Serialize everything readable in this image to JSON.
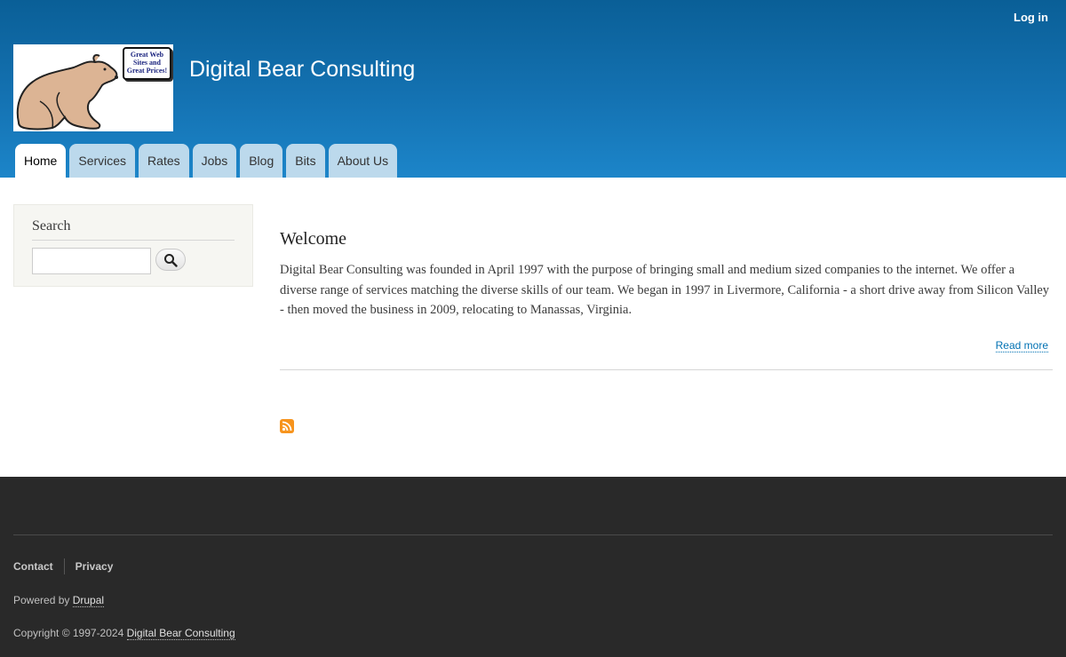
{
  "header": {
    "login_label": "Log in",
    "site_name": "Digital Bear Consulting",
    "logo_sign_lines": [
      "Great Web",
      "Sites and",
      "Great Prices!"
    ]
  },
  "tabs": [
    {
      "label": "Home",
      "active": true
    },
    {
      "label": "Services"
    },
    {
      "label": "Rates"
    },
    {
      "label": "Jobs"
    },
    {
      "label": "Blog"
    },
    {
      "label": "Bits"
    },
    {
      "label": "About Us"
    }
  ],
  "sidebar": {
    "search_title": "Search",
    "search_value": ""
  },
  "article": {
    "title": "Welcome",
    "body": "Digital Bear Consulting was founded in April 1997 with the purpose of bringing small and medium sized companies to the internet. We offer a diverse range of services matching the diverse skills of our team. We began in 1997 in Livermore, California - a short drive away from Silicon Valley - then moved the business in 2009, relocating to Manassas, Virginia.",
    "read_more": "Read more"
  },
  "footer": {
    "menu": [
      "Contact",
      "Privacy"
    ],
    "powered_prefix": "Powered by ",
    "powered_link": "Drupal",
    "copyright_prefix": "Copyright © 1997-2024 ",
    "copyright_link": "Digital Bear Consulting"
  },
  "colors": {
    "header_top": "#0a5f97",
    "header_bottom": "#1c85c9",
    "tab_bg": "#bcd9ec",
    "link": "#0071b3",
    "footer_bg": "#292929",
    "feed_icon": "#f7941d"
  },
  "icons": {
    "search_button": "magnifier-icon",
    "feed": "rss-feed-icon"
  }
}
